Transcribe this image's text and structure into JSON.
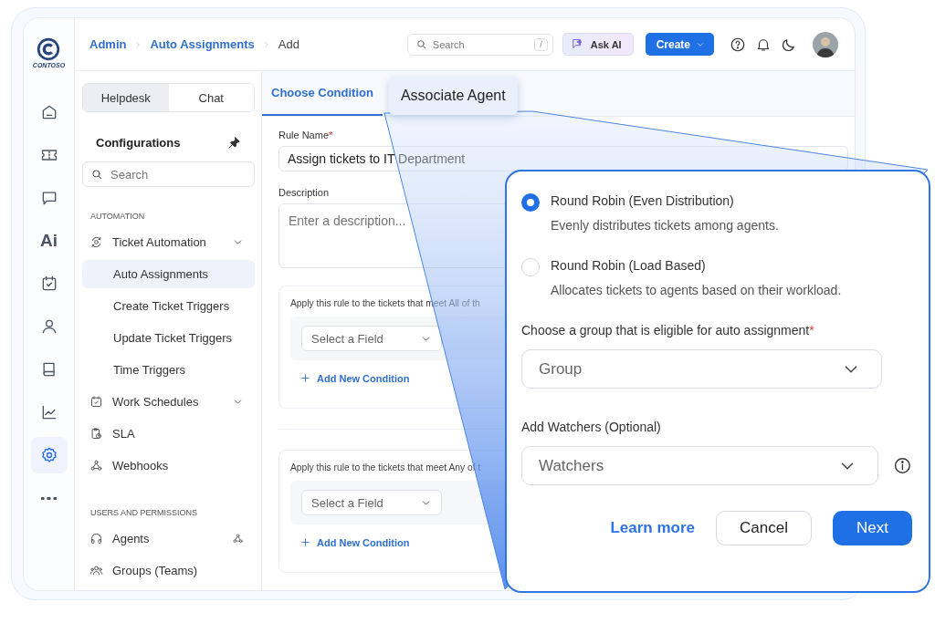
{
  "rail": {
    "logo": "CONTOSO",
    "items": [
      {
        "kind": "home",
        "selected": false
      },
      {
        "kind": "ticket",
        "selected": false
      },
      {
        "kind": "chat",
        "selected": false
      },
      {
        "kind": "text",
        "label": "Ai",
        "selected": false
      },
      {
        "kind": "calendar",
        "selected": false
      },
      {
        "kind": "user",
        "selected": false
      },
      {
        "kind": "book",
        "selected": false
      },
      {
        "kind": "chart",
        "selected": false
      },
      {
        "kind": "settings",
        "selected": true
      },
      {
        "kind": "more",
        "selected": false
      }
    ]
  },
  "header": {
    "breadcrumbs": [
      "Admin",
      "Auto Assignments",
      "Add"
    ],
    "search": {
      "placeholder": "Search",
      "shortcut": "/"
    },
    "ask_ai": "Ask AI",
    "create": "Create"
  },
  "sidebar": {
    "tabs": [
      {
        "label": "Helpdesk",
        "selected": true
      },
      {
        "label": "Chat",
        "selected": false
      }
    ],
    "title": "Configurations",
    "search": {
      "placeholder": "Search"
    },
    "sections": [
      {
        "title": "AUTOMATION",
        "items": [
          {
            "label": "Ticket Automation",
            "kind": "automation",
            "chevron": true,
            "selected": false,
            "children": [
              {
                "label": "Auto Assignments",
                "selected": true
              },
              {
                "label": "Create Ticket Triggers",
                "selected": false
              },
              {
                "label": "Update Ticket Triggers",
                "selected": false
              },
              {
                "label": "Time Triggers",
                "selected": false
              }
            ]
          },
          {
            "label": "Work Schedules",
            "kind": "calendar",
            "chevron": true,
            "selected": false
          },
          {
            "label": "SLA",
            "kind": "clipboard",
            "chevron": false,
            "selected": false
          },
          {
            "label": "Webhooks",
            "kind": "webhook",
            "chevron": false,
            "selected": false
          }
        ]
      },
      {
        "title": "USERS AND PERMISSIONS",
        "items": [
          {
            "label": "Agents",
            "kind": "headset",
            "chevron": false,
            "trailing": true,
            "selected": false
          },
          {
            "label": "Groups (Teams)",
            "kind": "group",
            "chevron": false,
            "selected": false
          }
        ]
      }
    ]
  },
  "main": {
    "tabs": [
      {
        "label": "Choose Condition",
        "selected": true,
        "highlighted": false
      },
      {
        "label": "Associate Agent",
        "selected": false,
        "highlighted": true
      }
    ],
    "rule_name": {
      "label": "Rule Name",
      "required_mark": "*",
      "value": "Assign tickets to IT Department"
    },
    "description": {
      "label": "Description",
      "placeholder": "Enter a description..."
    },
    "conditions": [
      {
        "text": "Apply this rule to the tickets that meet All of th",
        "select_placeholder": "Select a Field",
        "add": "Add New Condition"
      },
      {
        "text": "Apply this rule to the tickets that meet Any of t",
        "select_placeholder": "Select a Field",
        "add": "Add New Condition"
      }
    ]
  },
  "popup": {
    "options": [
      {
        "title": "Round Robin (Even Distribution)",
        "description": "Evenly distributes tickets among agents.",
        "selected": true
      },
      {
        "title": "Round Robin (Load Based)",
        "description": "Allocates tickets to agents based on their workload.",
        "selected": false
      }
    ],
    "group": {
      "label": "Choose a group that is eligible for auto assignment",
      "required_mark": "*",
      "placeholder": "Group",
      "info": false
    },
    "watchers": {
      "label": "Add Watchers (Optional)",
      "placeholder": "Watchers",
      "info": true
    },
    "learn_more": "Learn more",
    "cancel": "Cancel",
    "next": "Next"
  }
}
